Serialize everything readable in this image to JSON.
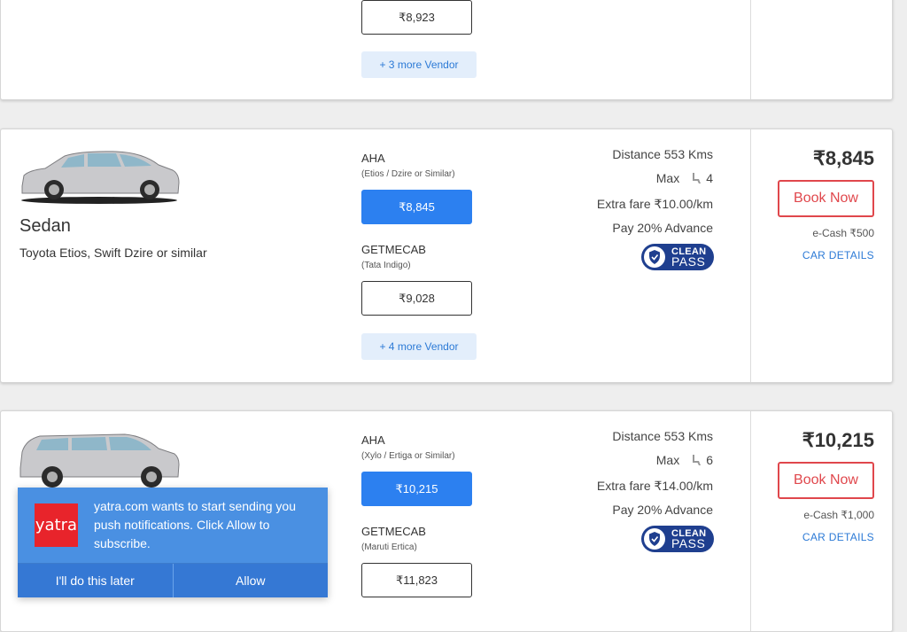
{
  "cards": [
    {
      "vendor2_price": "₹8,923",
      "more_vendor": "+ 3 more Vendor"
    },
    {
      "car_type": "Sedan",
      "car_models": "Toyota Etios, Swift Dzire or similar",
      "vendor1": {
        "name": "AHA",
        "sub": "(Etios / Dzire or Similar)",
        "price": "₹8,845"
      },
      "vendor2": {
        "name": "GETMECAB",
        "sub": "(Tata Indigo)",
        "price": "₹9,028"
      },
      "more_vendor": "+ 4 more Vendor",
      "distance": "Distance 553 Kms",
      "max_label": "Max",
      "seats": "4",
      "extra_fare": "Extra fare ₹10.00/km",
      "advance": "Pay 20% Advance",
      "total_price": "₹8,845",
      "book_label": "Book Now",
      "ecash": "e-Cash ₹500",
      "details_label": "CAR DETAILS"
    },
    {
      "vendor1": {
        "name": "AHA",
        "sub": "(Xylo / Ertiga or Similar)",
        "price": "₹10,215"
      },
      "vendor2": {
        "name": "GETMECAB",
        "sub": "(Maruti Ertica)",
        "price": "₹11,823"
      },
      "distance": "Distance 553 Kms",
      "max_label": "Max",
      "seats": "6",
      "extra_fare": "Extra fare ₹14.00/km",
      "advance": "Pay 20% Advance",
      "total_price": "₹10,215",
      "book_label": "Book Now",
      "ecash": "e-Cash ₹1,000",
      "details_label": "CAR DETAILS"
    }
  ],
  "clean_pass": {
    "line1": "CLEAN",
    "line2": "PASS"
  },
  "push": {
    "logo_text": "yatra",
    "message": "yatra.com wants to start sending you push notifications. Click Allow to subscribe.",
    "later_label": "I'll do this later",
    "allow_label": "Allow"
  },
  "colors": {
    "primary_blue": "#2c80f0",
    "book_red": "#e0474c",
    "clean_pass_navy": "#1f3f8f",
    "popup_blue": "#4a90e2"
  }
}
